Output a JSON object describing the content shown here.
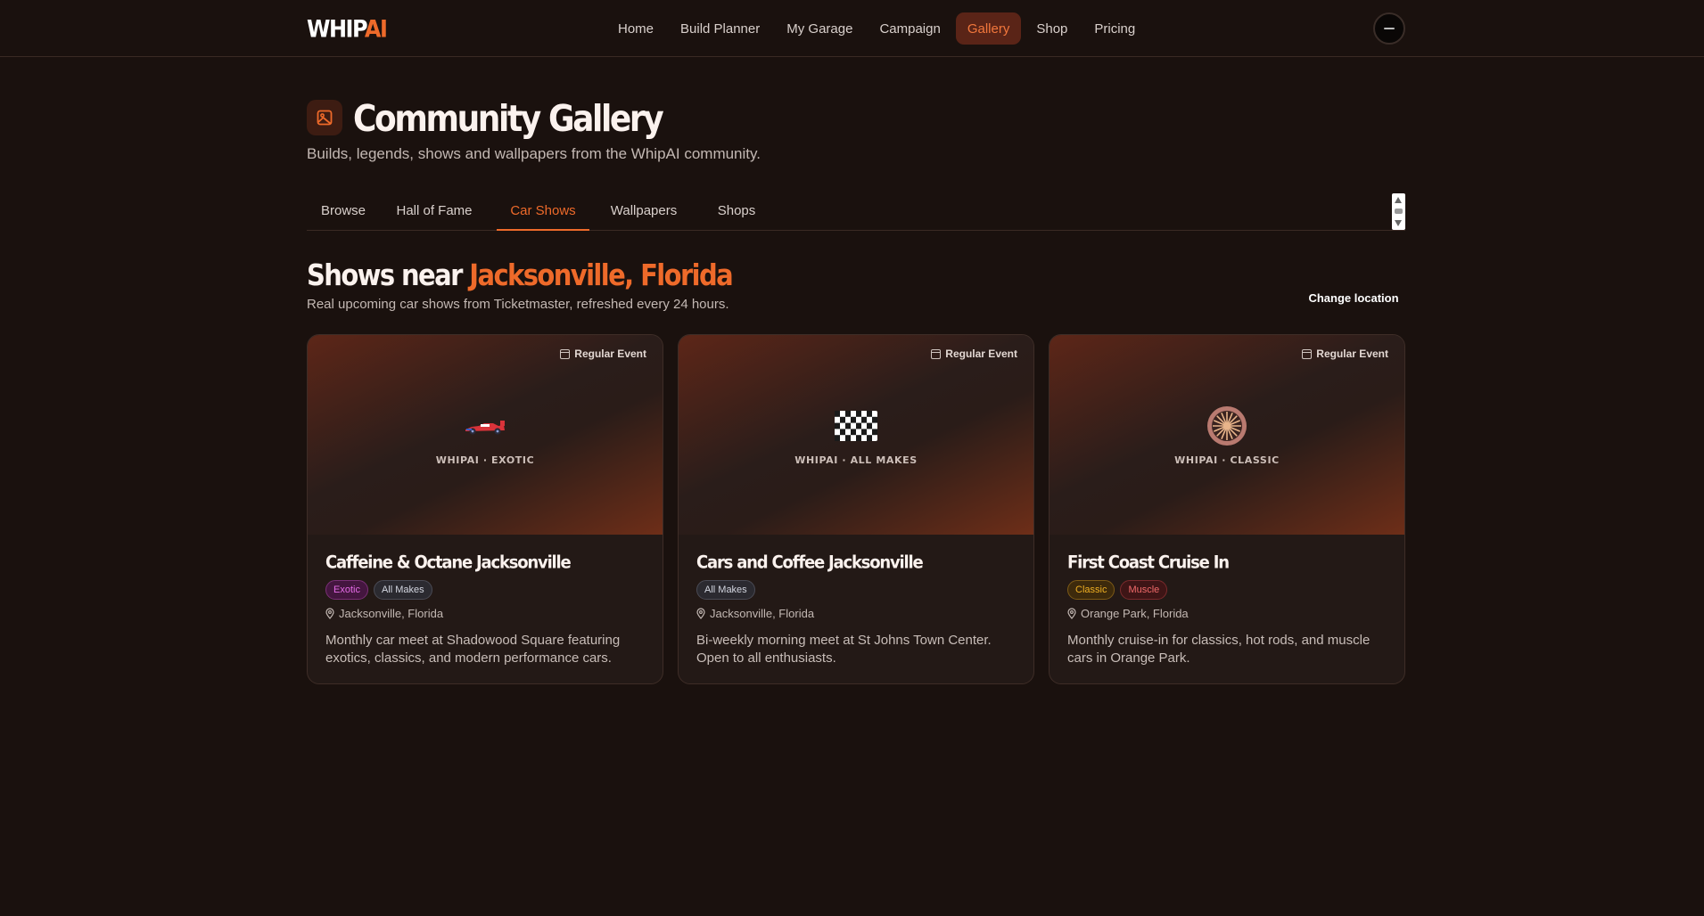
{
  "brand": {
    "logo_main": "WHIP",
    "logo_accent": "AI"
  },
  "nav": {
    "items": [
      {
        "label": "Home"
      },
      {
        "label": "Build Planner"
      },
      {
        "label": "My Garage"
      },
      {
        "label": "Campaign"
      },
      {
        "label": "Gallery",
        "active": true
      },
      {
        "label": "Shop"
      },
      {
        "label": "Pricing"
      }
    ]
  },
  "header": {
    "title": "Community Gallery",
    "subtitle": "Builds, legends, shows and wallpapers from the WhipAI community.",
    "icon": "image-icon"
  },
  "tabs": [
    {
      "label": "Browse"
    },
    {
      "label": "Hall of Fame"
    },
    {
      "label": "Car Shows",
      "active": true
    },
    {
      "label": "Wallpapers"
    },
    {
      "label": "Shops"
    }
  ],
  "section": {
    "title_prefix": "Shows near ",
    "location": "Jacksonville, Florida",
    "subtitle": "Real upcoming car shows from Ticketmaster, refreshed every 24 hours.",
    "change_location": "Change location"
  },
  "cards": [
    {
      "event_type": "Regular Event",
      "hero_icon": "race-car-icon",
      "hero_caption": "WHIPAI · EXOTIC",
      "title": "Caffeine & Octane Jacksonville",
      "tags": [
        "Exotic",
        "All Makes"
      ],
      "location": "Jacksonville, Florida",
      "description": "Monthly car meet at Shadowood Square featuring exotics, classics, and modern performance cars."
    },
    {
      "event_type": "Regular Event",
      "hero_icon": "checkered-flag-icon",
      "hero_caption": "WHIPAI · ALL MAKES",
      "title": "Cars and Coffee Jacksonville",
      "tags": [
        "All Makes"
      ],
      "location": "Jacksonville, Florida",
      "description": "Bi-weekly morning meet at St Johns Town Center. Open to all enthusiasts."
    },
    {
      "event_type": "Regular Event",
      "hero_icon": "wheel-icon",
      "hero_caption": "WHIPAI · CLASSIC",
      "title": "First Coast Cruise In",
      "tags": [
        "Classic",
        "Muscle"
      ],
      "location": "Orange Park, Florida",
      "description": "Monthly cruise-in for classics, hot rods, and muscle cars in Orange Park."
    }
  ],
  "colors": {
    "accent": "#ee6a2a",
    "background": "#1a110e"
  }
}
